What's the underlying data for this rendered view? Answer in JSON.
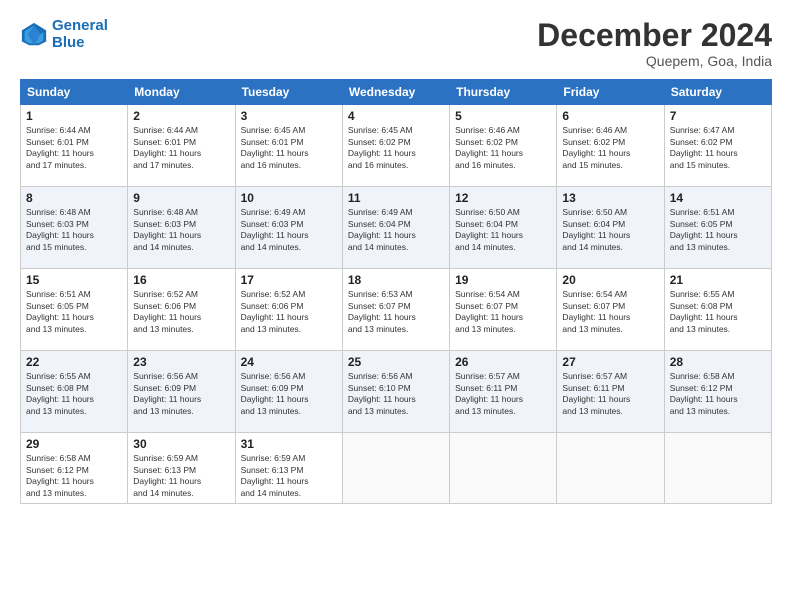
{
  "header": {
    "logo_line1": "General",
    "logo_line2": "Blue",
    "month": "December 2024",
    "location": "Quepem, Goa, India"
  },
  "days_of_week": [
    "Sunday",
    "Monday",
    "Tuesday",
    "Wednesday",
    "Thursday",
    "Friday",
    "Saturday"
  ],
  "weeks": [
    [
      {
        "day": "1",
        "detail": "Sunrise: 6:44 AM\nSunset: 6:01 PM\nDaylight: 11 hours\nand 17 minutes."
      },
      {
        "day": "2",
        "detail": "Sunrise: 6:44 AM\nSunset: 6:01 PM\nDaylight: 11 hours\nand 17 minutes."
      },
      {
        "day": "3",
        "detail": "Sunrise: 6:45 AM\nSunset: 6:01 PM\nDaylight: 11 hours\nand 16 minutes."
      },
      {
        "day": "4",
        "detail": "Sunrise: 6:45 AM\nSunset: 6:02 PM\nDaylight: 11 hours\nand 16 minutes."
      },
      {
        "day": "5",
        "detail": "Sunrise: 6:46 AM\nSunset: 6:02 PM\nDaylight: 11 hours\nand 16 minutes."
      },
      {
        "day": "6",
        "detail": "Sunrise: 6:46 AM\nSunset: 6:02 PM\nDaylight: 11 hours\nand 15 minutes."
      },
      {
        "day": "7",
        "detail": "Sunrise: 6:47 AM\nSunset: 6:02 PM\nDaylight: 11 hours\nand 15 minutes."
      }
    ],
    [
      {
        "day": "8",
        "detail": "Sunrise: 6:48 AM\nSunset: 6:03 PM\nDaylight: 11 hours\nand 15 minutes."
      },
      {
        "day": "9",
        "detail": "Sunrise: 6:48 AM\nSunset: 6:03 PM\nDaylight: 11 hours\nand 14 minutes."
      },
      {
        "day": "10",
        "detail": "Sunrise: 6:49 AM\nSunset: 6:03 PM\nDaylight: 11 hours\nand 14 minutes."
      },
      {
        "day": "11",
        "detail": "Sunrise: 6:49 AM\nSunset: 6:04 PM\nDaylight: 11 hours\nand 14 minutes."
      },
      {
        "day": "12",
        "detail": "Sunrise: 6:50 AM\nSunset: 6:04 PM\nDaylight: 11 hours\nand 14 minutes."
      },
      {
        "day": "13",
        "detail": "Sunrise: 6:50 AM\nSunset: 6:04 PM\nDaylight: 11 hours\nand 14 minutes."
      },
      {
        "day": "14",
        "detail": "Sunrise: 6:51 AM\nSunset: 6:05 PM\nDaylight: 11 hours\nand 13 minutes."
      }
    ],
    [
      {
        "day": "15",
        "detail": "Sunrise: 6:51 AM\nSunset: 6:05 PM\nDaylight: 11 hours\nand 13 minutes."
      },
      {
        "day": "16",
        "detail": "Sunrise: 6:52 AM\nSunset: 6:06 PM\nDaylight: 11 hours\nand 13 minutes."
      },
      {
        "day": "17",
        "detail": "Sunrise: 6:52 AM\nSunset: 6:06 PM\nDaylight: 11 hours\nand 13 minutes."
      },
      {
        "day": "18",
        "detail": "Sunrise: 6:53 AM\nSunset: 6:07 PM\nDaylight: 11 hours\nand 13 minutes."
      },
      {
        "day": "19",
        "detail": "Sunrise: 6:54 AM\nSunset: 6:07 PM\nDaylight: 11 hours\nand 13 minutes."
      },
      {
        "day": "20",
        "detail": "Sunrise: 6:54 AM\nSunset: 6:07 PM\nDaylight: 11 hours\nand 13 minutes."
      },
      {
        "day": "21",
        "detail": "Sunrise: 6:55 AM\nSunset: 6:08 PM\nDaylight: 11 hours\nand 13 minutes."
      }
    ],
    [
      {
        "day": "22",
        "detail": "Sunrise: 6:55 AM\nSunset: 6:08 PM\nDaylight: 11 hours\nand 13 minutes."
      },
      {
        "day": "23",
        "detail": "Sunrise: 6:56 AM\nSunset: 6:09 PM\nDaylight: 11 hours\nand 13 minutes."
      },
      {
        "day": "24",
        "detail": "Sunrise: 6:56 AM\nSunset: 6:09 PM\nDaylight: 11 hours\nand 13 minutes."
      },
      {
        "day": "25",
        "detail": "Sunrise: 6:56 AM\nSunset: 6:10 PM\nDaylight: 11 hours\nand 13 minutes."
      },
      {
        "day": "26",
        "detail": "Sunrise: 6:57 AM\nSunset: 6:11 PM\nDaylight: 11 hours\nand 13 minutes."
      },
      {
        "day": "27",
        "detail": "Sunrise: 6:57 AM\nSunset: 6:11 PM\nDaylight: 11 hours\nand 13 minutes."
      },
      {
        "day": "28",
        "detail": "Sunrise: 6:58 AM\nSunset: 6:12 PM\nDaylight: 11 hours\nand 13 minutes."
      }
    ],
    [
      {
        "day": "29",
        "detail": "Sunrise: 6:58 AM\nSunset: 6:12 PM\nDaylight: 11 hours\nand 13 minutes."
      },
      {
        "day": "30",
        "detail": "Sunrise: 6:59 AM\nSunset: 6:13 PM\nDaylight: 11 hours\nand 14 minutes."
      },
      {
        "day": "31",
        "detail": "Sunrise: 6:59 AM\nSunset: 6:13 PM\nDaylight: 11 hours\nand 14 minutes."
      },
      null,
      null,
      null,
      null
    ]
  ]
}
